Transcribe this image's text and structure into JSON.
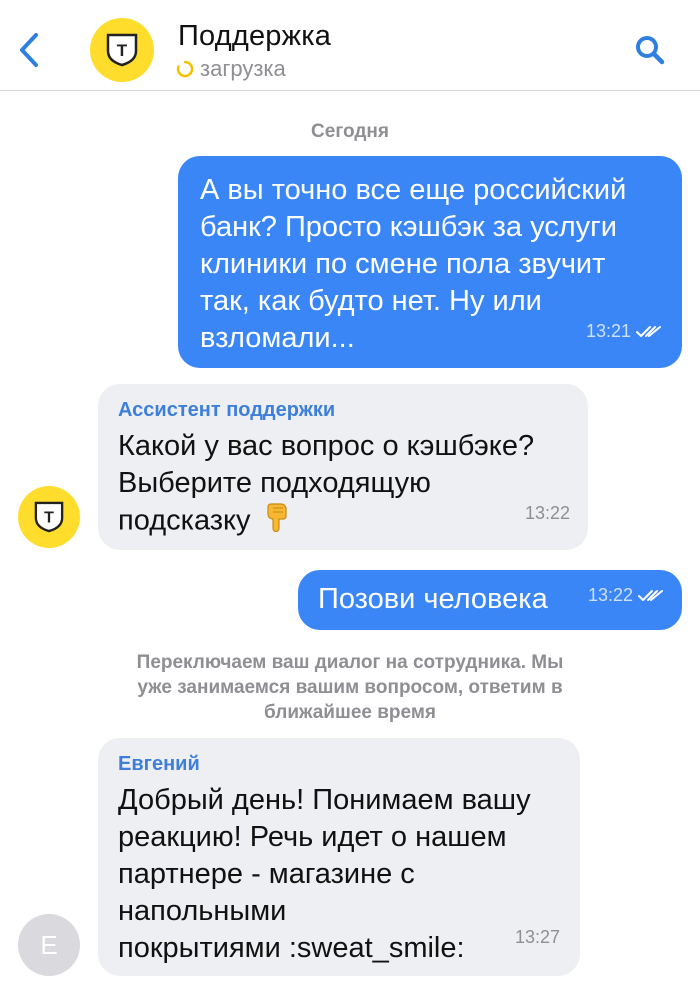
{
  "header": {
    "title": "Поддержка",
    "status": "загрузка",
    "bank_logo_letter": "Т",
    "icons": {
      "back": "chevron-left-icon",
      "search": "search-icon",
      "loading": "spinner-icon"
    }
  },
  "date_separator": "Сегодня",
  "messages": [
    {
      "direction": "outgoing",
      "text": "А вы точно все еще российский банк? Просто кэшбэк за услуги клиники по смене пола звучит так, как будто нет. Ну или взломали...",
      "lines": [
        "А вы точно все еще российский",
        "банк? Просто кэшбэк за услуги",
        "клиники по смене пола звучит",
        "так, как будто нет. Ну или",
        "взломали..."
      ],
      "time": "13:21",
      "status_icon": "double-check-icon"
    },
    {
      "direction": "incoming",
      "sender": "Ассистент поддержки",
      "lines": [
        "Какой у вас вопрос о кэшбэке?",
        "Выберите подходящую",
        "подсказку"
      ],
      "emoji": "pointing-down-hand-icon",
      "time": "13:22",
      "avatar_letter": "Т"
    },
    {
      "direction": "outgoing",
      "text": "Позови человека",
      "time": "13:22",
      "status_icon": "double-check-icon"
    },
    {
      "direction": "incoming",
      "sender": "Евгений",
      "lines": [
        "Добрый день! Понимаем вашу",
        "реакцию! Речь идет о нашем",
        "партнере - магазине с",
        "напольными",
        "покрытиями :sweat_smile:"
      ],
      "time": "13:27",
      "avatar_letter": "E"
    }
  ],
  "system_message": {
    "lines": [
      "Переключаем ваш диалог на сотрудника. Мы",
      "уже занимаемся вашим вопросом, ответим в",
      "ближайшее время"
    ]
  },
  "colors": {
    "accent": "#3a86f7",
    "brand_yellow": "#ffdd2d",
    "incoming_bubble": "#eeeff3",
    "sender_name": "#3d7fd9",
    "muted": "#8e8e93"
  }
}
